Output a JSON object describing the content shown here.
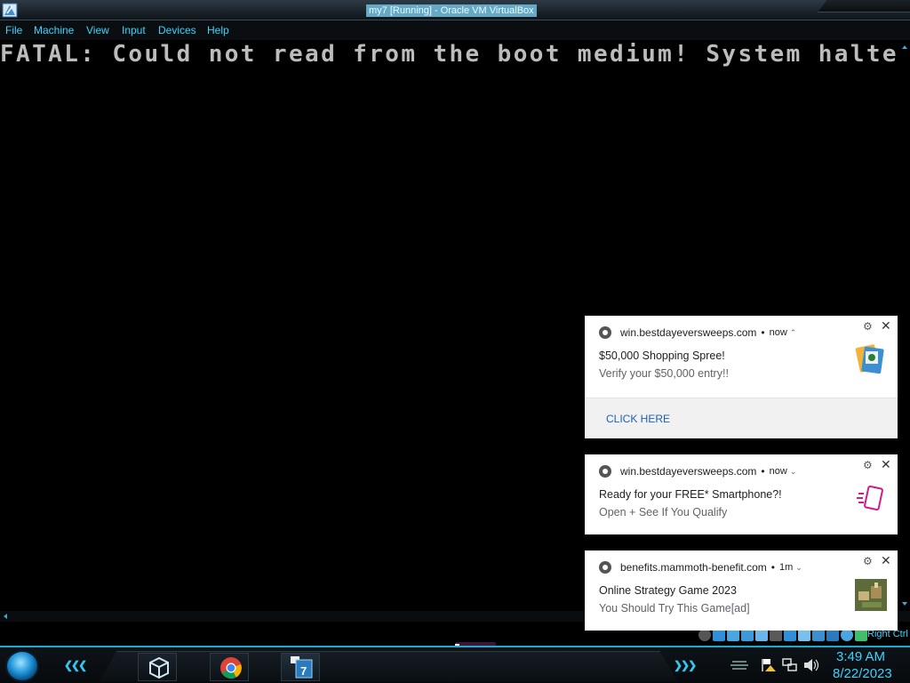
{
  "window": {
    "title": "my7 [Running] - Oracle VM VirtualBox",
    "menu": [
      "File",
      "Machine",
      "View",
      "Input",
      "Devices",
      "Help"
    ]
  },
  "vm": {
    "boot_message": "FATAL: Could not read from the boot medium! System halted."
  },
  "statusbar": {
    "host_key": "Right Ctrl",
    "icons": [
      "harddisk-icon",
      "optical-drive-icon",
      "audio-icon",
      "network-icon",
      "usb-icon",
      "shared-folder-icon",
      "display-icon",
      "recording-icon",
      "cpu-icon",
      "vm-state-icon",
      "mouse-integration-icon",
      "keyboard-icon"
    ]
  },
  "notifications": [
    {
      "source": "win.bestdayeversweeps.com",
      "time": "now",
      "title": "$50,000 Shopping Spree!",
      "body": "Verify your $50,000 entry!!",
      "action": "CLICK HERE",
      "image": "cards-icon",
      "expanded": true
    },
    {
      "source": "win.bestdayeversweeps.com",
      "time": "now",
      "title": "Ready for your FREE* Smartphone?!",
      "body": "Open + See If You Qualify",
      "image": "smartphone-icon",
      "expanded": false
    },
    {
      "source": "benefits.mammoth-benefit.com",
      "time": "1m",
      "title": "Online Strategy Game 2023",
      "body": "You Should Try This Game[ad]",
      "image": "game-thumbnail",
      "expanded": false
    }
  ],
  "taskbar": {
    "apps": [
      "virtualbox-icon",
      "chrome-icon",
      "windows7-vm-icon"
    ],
    "clock": {
      "time": "3:49 AM",
      "date": "8/22/2023"
    },
    "tray": [
      "flag-warning-icon",
      "network-icon",
      "volume-icon"
    ]
  },
  "colors": {
    "accent": "#36d6ff",
    "boot_text": "#bcbcbc",
    "link": "#1a5fb4"
  }
}
